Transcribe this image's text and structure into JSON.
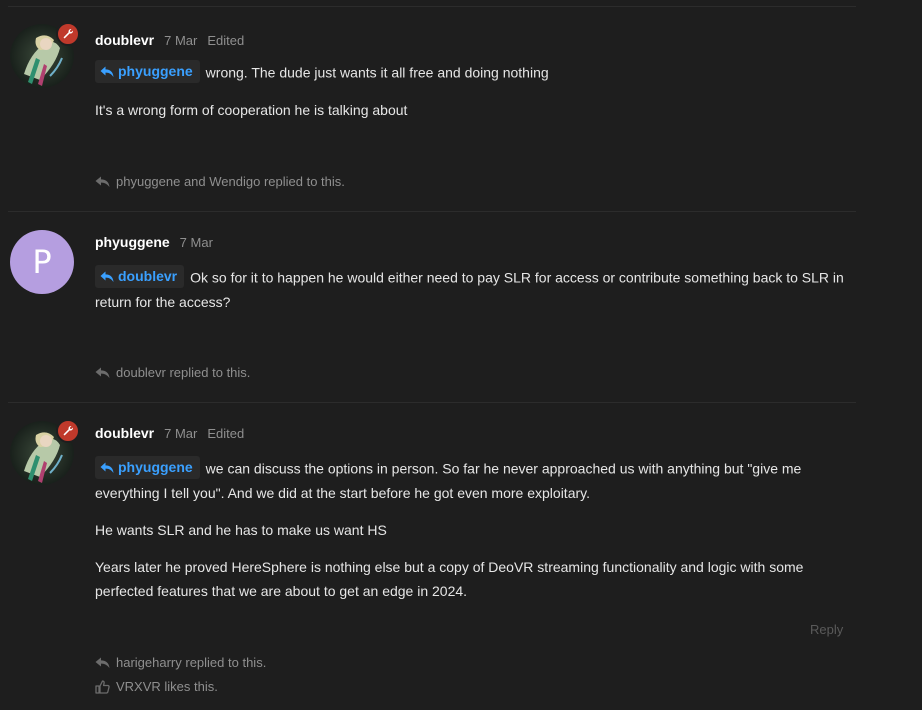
{
  "posts": [
    {
      "username": "doublevr",
      "date": "7 Mar",
      "edited": "Edited",
      "quote_user": "phyuggene",
      "first_line": "wrong. The dude just wants it all free and doing nothing",
      "paragraphs": [
        "It's a wrong form of cooperation he is talking about"
      ],
      "replied_text": "phyuggene and Wendigo replied to this."
    },
    {
      "username": "phyuggene",
      "date": "7 Mar",
      "avatar_letter": "P",
      "quote_user": "doublevr",
      "first_line": "Ok so for it to happen he would either need to pay SLR for access or contribute something back to SLR in return for the access?",
      "replied_text": "doublevr replied to this."
    },
    {
      "username": "doublevr",
      "date": "7 Mar",
      "edited": "Edited",
      "quote_user": "phyuggene",
      "first_line": "we can discuss the options in person. So far he never approached us with anything but \"give me everything I tell you\". And we did at the start before he got even more exploitary.",
      "paragraphs": [
        "He wants SLR and he has to make us want HS",
        "Years later he proved HereSphere is nothing else but a copy of DeoVR streaming functionality and logic with some perfected features that we are about to get an edge in 2024."
      ],
      "reply_label": "Reply",
      "replied_text": "harigeharry replied to this.",
      "likes_text": "VRXVR likes this."
    }
  ],
  "colors": {
    "background": "#1e1e1e",
    "quote_link": "#3aa0ff",
    "mod_badge": "#c0392b",
    "avatar_p": "#b59ee0",
    "muted": "#8f8f8f"
  },
  "icons": {
    "reply": "reply-arrow-icon",
    "like": "thumbs-up-icon",
    "mod": "wrench-icon"
  }
}
